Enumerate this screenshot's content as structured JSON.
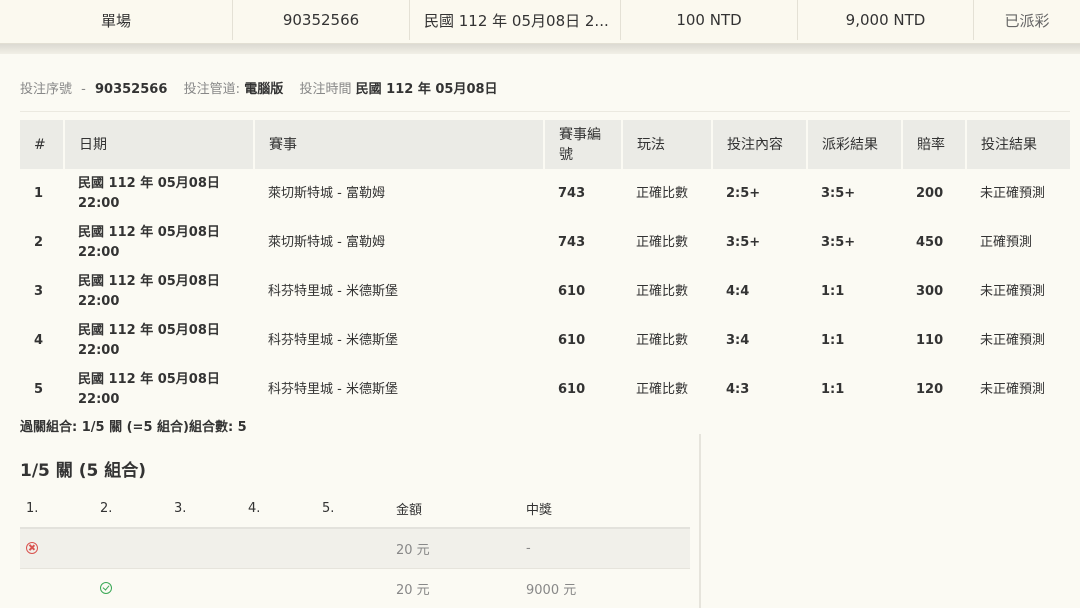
{
  "summary": {
    "type": "單場",
    "serial": "90352566",
    "time": "民國 112 年 05月08日 2...",
    "stake": "100 NTD",
    "payout": "9,000 NTD",
    "status": "已派彩"
  },
  "meta": {
    "serial_label": "投注序號",
    "serial_sep": "-",
    "serial_value": "90352566",
    "channel_label": "投注管道:",
    "channel_value": "電腦版",
    "time_label": "投注時間",
    "time_value": "民國 112 年 05月08日"
  },
  "bets": {
    "headers": [
      "#",
      "日期",
      "賽事",
      "賽事編號",
      "玩法",
      "投注內容",
      "派彩結果",
      "賠率",
      "投注結果"
    ],
    "header_event_no_line1": "賽事編",
    "header_event_no_line2": "號",
    "rows": [
      {
        "n": "1",
        "date": "民國 112 年 05月08日",
        "time": "22:00",
        "match": "萊切斯特城 - 富勒姆",
        "no": "743",
        "play": "正確比數",
        "pick": "2:5+",
        "result": "3:5+",
        "odds": "200",
        "outcome": "未正確預測"
      },
      {
        "n": "2",
        "date": "民國 112 年 05月08日",
        "time": "22:00",
        "match": "萊切斯特城 - 富勒姆",
        "no": "743",
        "play": "正確比數",
        "pick": "3:5+",
        "result": "3:5+",
        "odds": "450",
        "outcome": "正確預測"
      },
      {
        "n": "3",
        "date": "民國 112 年 05月08日",
        "time": "22:00",
        "match": "科芬特里城 - 米德斯堡",
        "no": "610",
        "play": "正確比數",
        "pick": "4:4",
        "result": "1:1",
        "odds": "300",
        "outcome": "未正確預測"
      },
      {
        "n": "4",
        "date": "民國 112 年 05月08日",
        "time": "22:00",
        "match": "科芬特里城 - 米德斯堡",
        "no": "610",
        "play": "正確比數",
        "pick": "3:4",
        "result": "1:1",
        "odds": "110",
        "outcome": "未正確預測"
      },
      {
        "n": "5",
        "date": "民國 112 年 05月08日",
        "time": "22:00",
        "match": "科芬特里城 - 米德斯堡",
        "no": "610",
        "play": "正確比數",
        "pick": "4:3",
        "result": "1:1",
        "odds": "120",
        "outcome": "未正確預測"
      }
    ]
  },
  "combo_line": "過關組合: 1/5 關 (=5 組合)組合數: 5",
  "combos": {
    "title": "1/5 關 (5 組合)",
    "headers": [
      "1.",
      "2.",
      "3.",
      "4.",
      "5.",
      "金額",
      "中獎"
    ],
    "rows": [
      {
        "amount": "20 元",
        "prize": "-",
        "icon": "x-circle-icon"
      },
      {
        "amount": "20 元",
        "prize": "9000 元",
        "icon": "check-circle-icon"
      }
    ]
  },
  "colors": {
    "loss": "#d9534f",
    "win": "#3aa856",
    "header_bg": "#ebebe6"
  }
}
